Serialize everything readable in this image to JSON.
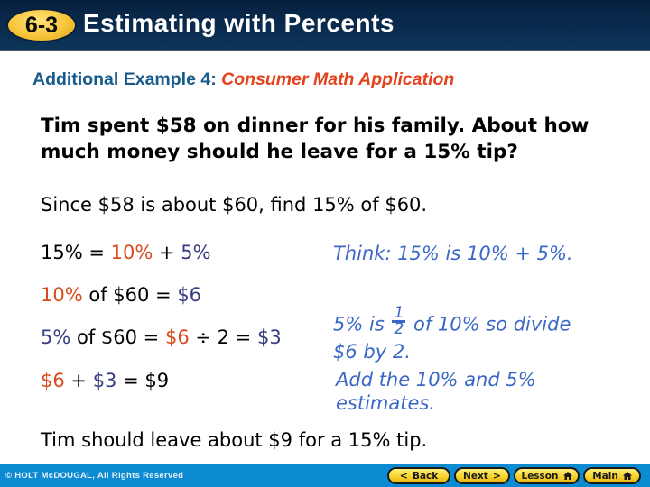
{
  "header": {
    "lesson_number": "6-3",
    "title": "Estimating with Percents"
  },
  "subtitle": {
    "lead": "Additional Example 4:",
    "topic": "Consumer Math Application"
  },
  "problem": "Tim spent $58 on dinner for his family. About how much money should he leave for a 15% tip?",
  "since": "Since $58 is about $60, find 15% of $60.",
  "work": {
    "line1": {
      "a": "15% = ",
      "b": "10%",
      "c": " + ",
      "d": "5%"
    },
    "line2": {
      "a": "10%",
      "b": " of $60 = ",
      "c": "$6"
    },
    "line3": {
      "a": "5%",
      "b": " of $60 = ",
      "c": "$6",
      "d": " ÷ 2 = ",
      "e": "$3"
    },
    "line4": {
      "a": "$6",
      "b": " + ",
      "c": "$3",
      "d": " = $9"
    }
  },
  "notes": {
    "think": "Think: 15% is 10% + 5%.",
    "half_pre": "5% is",
    "half_num": "1",
    "half_den": "2",
    "half_post": "of 10% so divide",
    "half_line2": "$6 by 2.",
    "add_line1": "Add the 10% and 5%",
    "add_line2": "estimates."
  },
  "answer": "Tim should leave about $9 for a 15% tip.",
  "footer": {
    "copyright": "© HOLT McDOUGAL, All Rights Reserved",
    "buttons": {
      "back": "Back",
      "next": "Next",
      "lesson": "Lesson",
      "main": "Main"
    }
  },
  "colors": {
    "header_bg": "#0a2c50",
    "badge": "#f7c53a",
    "subtitle_lead": "#175a8c",
    "subtitle_topic": "#e2421c",
    "orange_term": "#d94b1e",
    "navy_term": "#3a3d82",
    "note_text": "#3a67c6",
    "footer_bg": "#0c8ad2",
    "nav_button": "#f6d22a"
  }
}
